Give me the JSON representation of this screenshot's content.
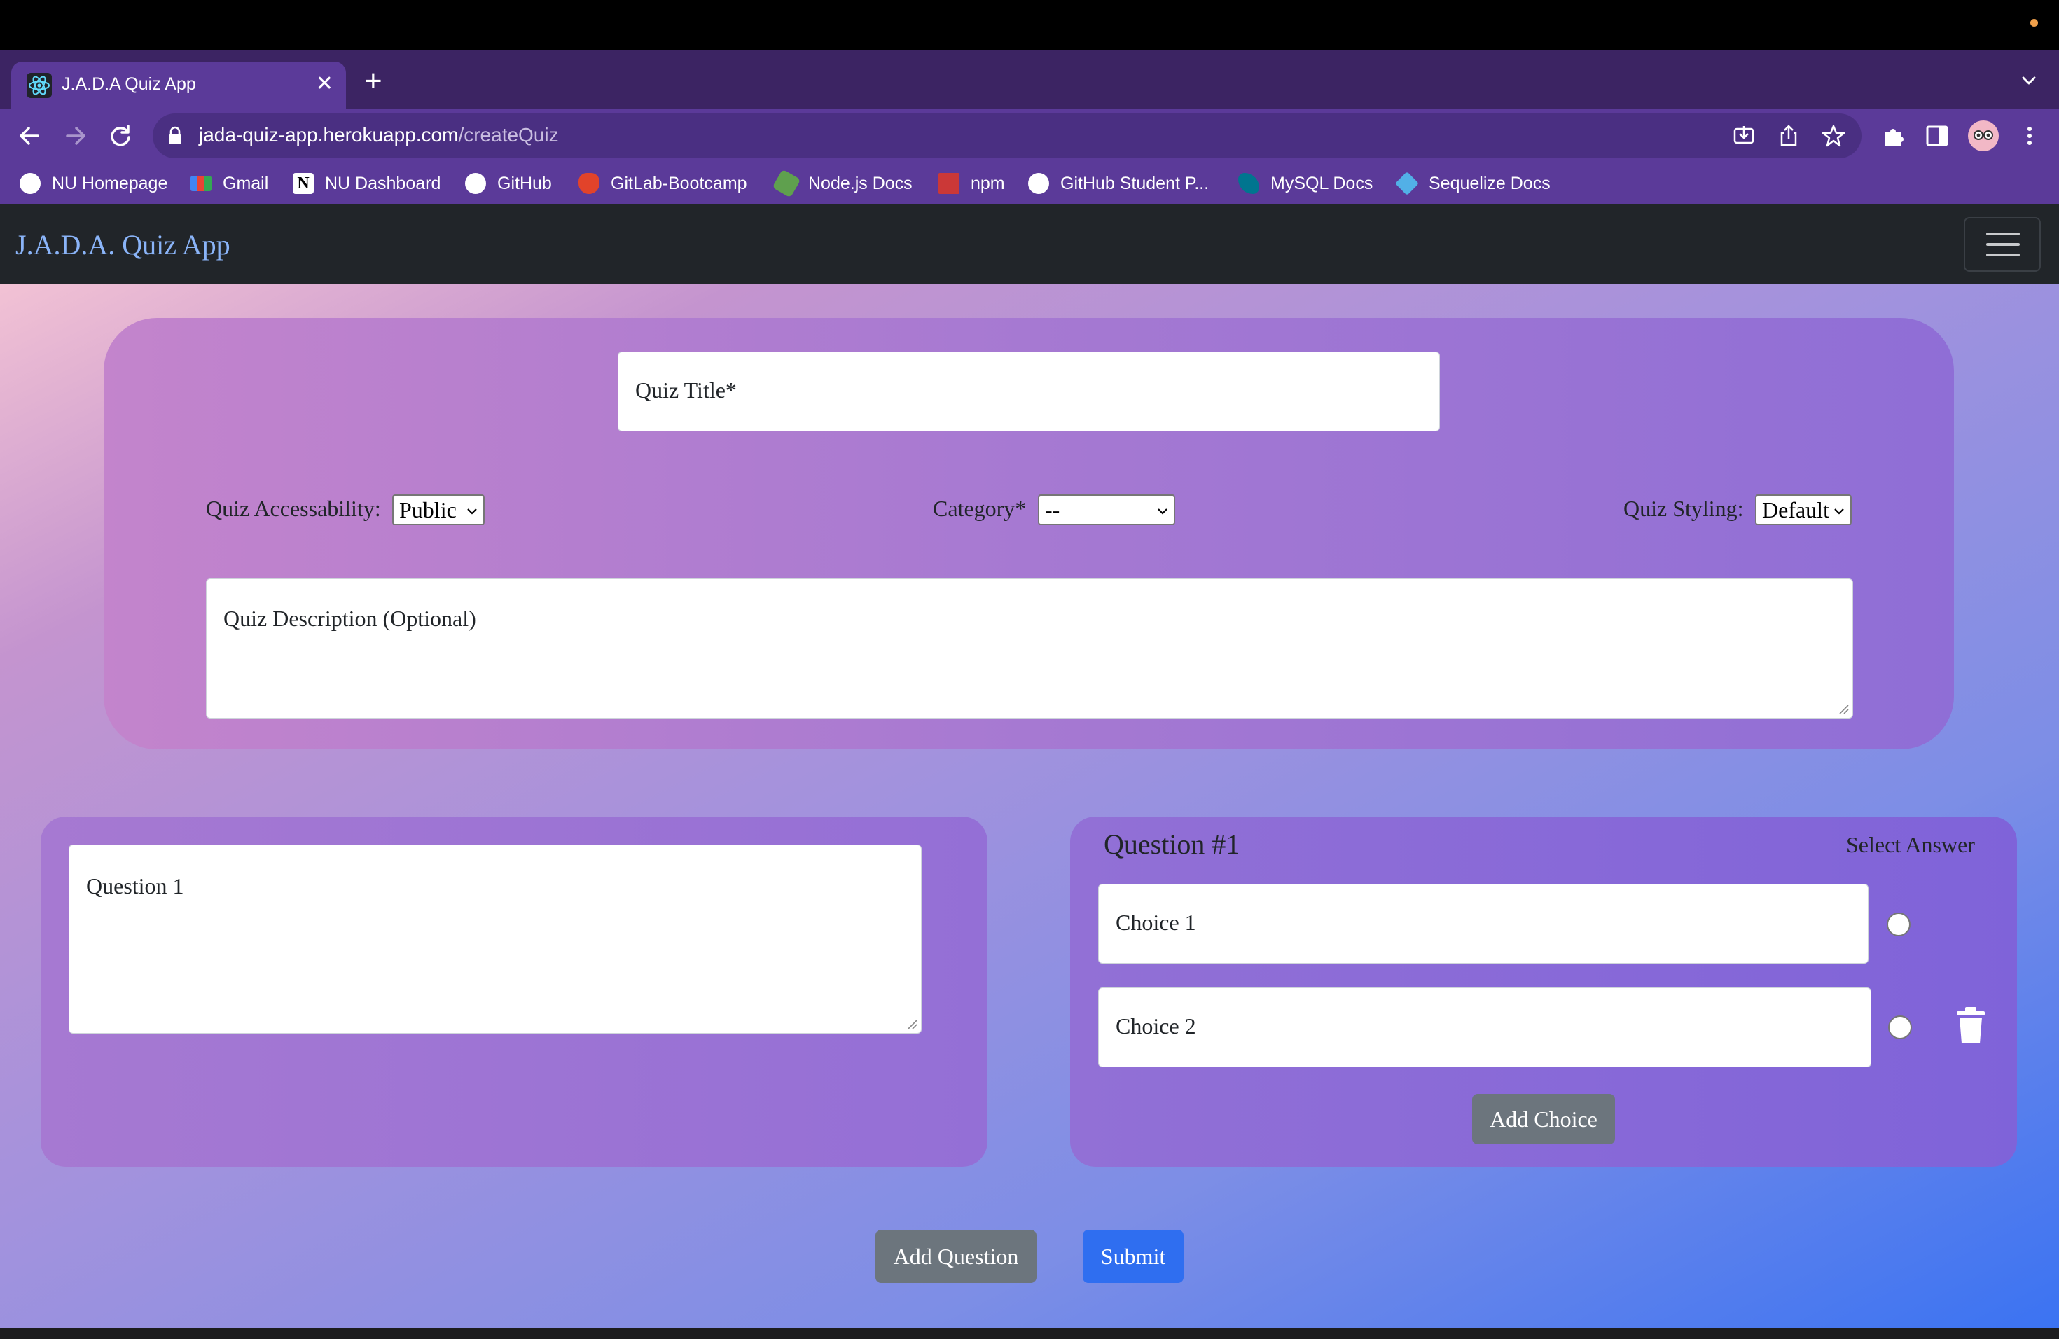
{
  "browser": {
    "tab_title": "J.A.D.A Quiz App",
    "new_tab_symbol": "+",
    "close_symbol": "✕",
    "url_host": "jada-quiz-app.herokuapp.com",
    "url_path": "/createQuiz",
    "bookmarks": [
      {
        "label": "NU Homepage",
        "icon": "globe-icon"
      },
      {
        "label": "Gmail",
        "icon": "gmail-icon"
      },
      {
        "label": "NU Dashboard",
        "icon": "notion-icon"
      },
      {
        "label": "GitHub",
        "icon": "github-icon"
      },
      {
        "label": "GitLab-Bootcamp",
        "icon": "gitlab-icon"
      },
      {
        "label": "Node.js Docs",
        "icon": "nodejs-icon"
      },
      {
        "label": "npm",
        "icon": "npm-icon"
      },
      {
        "label": "GitHub Student P...",
        "icon": "github-icon"
      },
      {
        "label": "MySQL Docs",
        "icon": "mysql-icon"
      },
      {
        "label": "Sequelize Docs",
        "icon": "sequelize-icon"
      }
    ]
  },
  "navbar": {
    "brand": "J.A.D.A. Quiz App"
  },
  "quiz": {
    "title_placeholder": "Quiz Title*",
    "accessibility_label": "Quiz Accessability:",
    "accessibility_value": "Public",
    "category_label": "Category*",
    "category_value": "--",
    "styling_label": "Quiz Styling:",
    "styling_value": "Default",
    "description_placeholder": "Quiz Description (Optional)"
  },
  "question": {
    "text_placeholder": "Question 1",
    "heading": "Question #1",
    "select_answer_label": "Select Answer",
    "choices": [
      {
        "placeholder": "Choice 1"
      },
      {
        "placeholder": "Choice 2"
      }
    ],
    "add_choice_label": "Add Choice"
  },
  "actions": {
    "add_question_label": "Add Question",
    "submit_label": "Submit"
  },
  "colors": {
    "navbar": "#212529",
    "brand": "#8ab4f8",
    "primary_button": "#2f6ef0",
    "secondary_button": "#6c757d",
    "chrome": "#5b3a99"
  }
}
